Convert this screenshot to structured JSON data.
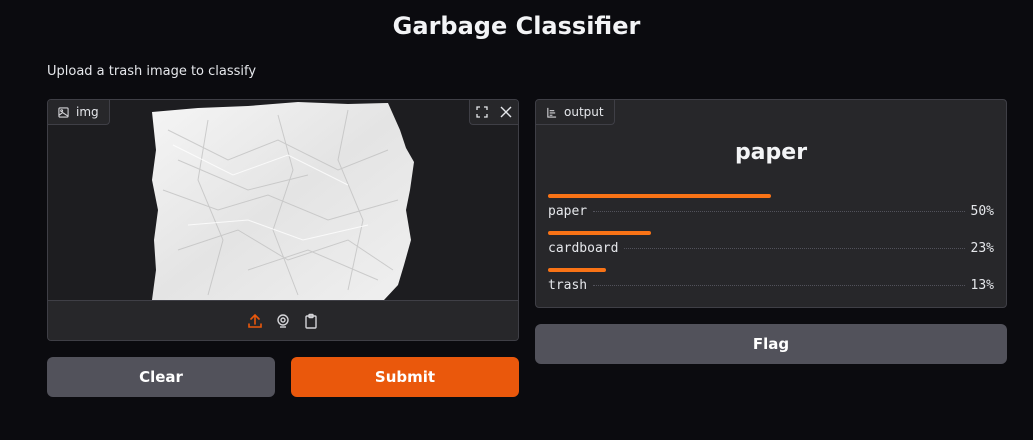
{
  "page": {
    "title": "Garbage Classifier",
    "description": "Upload a trash image to classify"
  },
  "input": {
    "label": "img",
    "label_icon": "image-icon",
    "tools": [
      "fullscreen-icon",
      "close-icon"
    ],
    "sources": [
      "upload-icon",
      "webcam-icon",
      "clipboard-icon"
    ],
    "accent_color": "#ea580c"
  },
  "output": {
    "label": "output",
    "label_icon": "label-icon",
    "predicted": "paper",
    "confidences": [
      {
        "label": "paper",
        "percent": "50%",
        "fraction": 0.5
      },
      {
        "label": "cardboard",
        "percent": "23%",
        "fraction": 0.23
      },
      {
        "label": "trash",
        "percent": "13%",
        "fraction": 0.13
      }
    ]
  },
  "buttons": {
    "clear": "Clear",
    "submit": "Submit",
    "flag": "Flag"
  },
  "colors": {
    "background": "#0b0b0f",
    "panel": "#27272a",
    "primary": "#ea580c",
    "secondary": "#52525b",
    "bar": "#f97316"
  }
}
